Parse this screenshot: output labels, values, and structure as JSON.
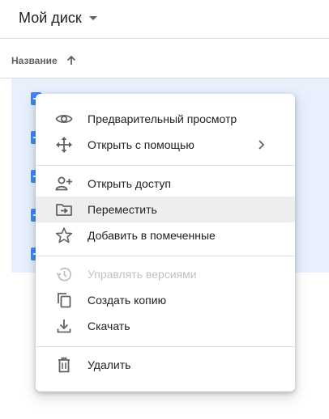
{
  "header": {
    "title": "Мой диск"
  },
  "files": {
    "column_name": "Название",
    "rows": 5
  },
  "menu": {
    "items": [
      {
        "label": "Предварительный просмотр",
        "icon": "eye-icon",
        "enabled": true
      },
      {
        "label": "Открыть с помощью",
        "icon": "move-arrows-icon",
        "enabled": true,
        "submenu": true
      },
      {
        "label": "Открыть доступ",
        "icon": "add-person-icon",
        "enabled": true
      },
      {
        "label": "Переместить",
        "icon": "move-to-folder-icon",
        "enabled": true,
        "highlighted": true
      },
      {
        "label": "Добавить в помеченные",
        "icon": "star-icon",
        "enabled": true
      },
      {
        "label": "Управлять версиями",
        "icon": "history-icon",
        "enabled": false
      },
      {
        "label": "Создать копию",
        "icon": "copy-icon",
        "enabled": true
      },
      {
        "label": "Скачать",
        "icon": "download-icon",
        "enabled": true
      },
      {
        "label": "Удалить",
        "icon": "trash-icon",
        "enabled": true
      }
    ]
  },
  "colors": {
    "selection": "#e8f0fe",
    "file_icon": "#4285f4",
    "icon_gray": "#5f6368",
    "disabled": "#bdc1c6",
    "highlight": "#eeeeee"
  }
}
